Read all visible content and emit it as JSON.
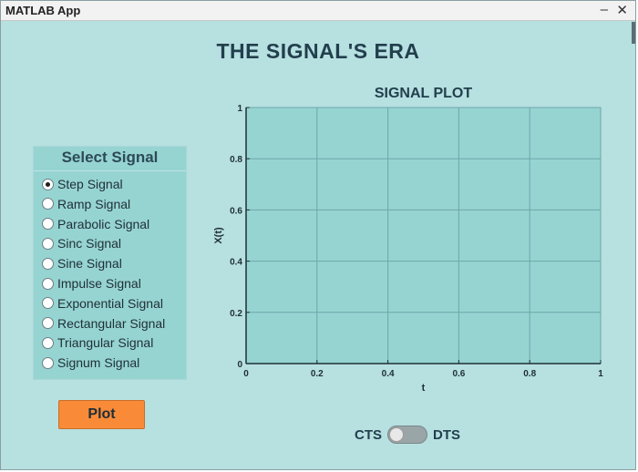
{
  "window": {
    "title": "MATLAB App",
    "minimize_symbol": "–",
    "close_symbol": "✕"
  },
  "app_title": "THE SIGNAL'S ERA",
  "panel": {
    "title": "Select Signal",
    "options": [
      {
        "label": "Step Signal",
        "checked": true
      },
      {
        "label": "Ramp Signal",
        "checked": false
      },
      {
        "label": "Parabolic Signal",
        "checked": false
      },
      {
        "label": "Sinc Signal",
        "checked": false
      },
      {
        "label": "Sine Signal",
        "checked": false
      },
      {
        "label": "Impulse Signal",
        "checked": false
      },
      {
        "label": "Exponential Signal",
        "checked": false
      },
      {
        "label": "Rectangular Signal",
        "checked": false
      },
      {
        "label": "Triangular Signal",
        "checked": false
      },
      {
        "label": "Signum Signal",
        "checked": false
      }
    ]
  },
  "plot_button": "Plot",
  "toggle": {
    "left_label": "CTS",
    "right_label": "DTS",
    "state": "CTS"
  },
  "colors": {
    "background": "#b7e0e1",
    "panel": "#96d4d2",
    "plot_area": "#96d4d2",
    "button": "#f98b38",
    "title_text": "#223f4d"
  },
  "chart_data": {
    "type": "line",
    "title": "SIGNAL PLOT",
    "xlabel": "t",
    "ylabel": "X(t)",
    "xlim": [
      0,
      1
    ],
    "ylim": [
      0,
      1
    ],
    "xticks": [
      "0",
      "0.2",
      "0.4",
      "0.6",
      "0.8",
      "1"
    ],
    "yticks": [
      "0",
      "0.2",
      "0.4",
      "0.6",
      "0.8",
      "1"
    ],
    "grid": true,
    "series": []
  }
}
